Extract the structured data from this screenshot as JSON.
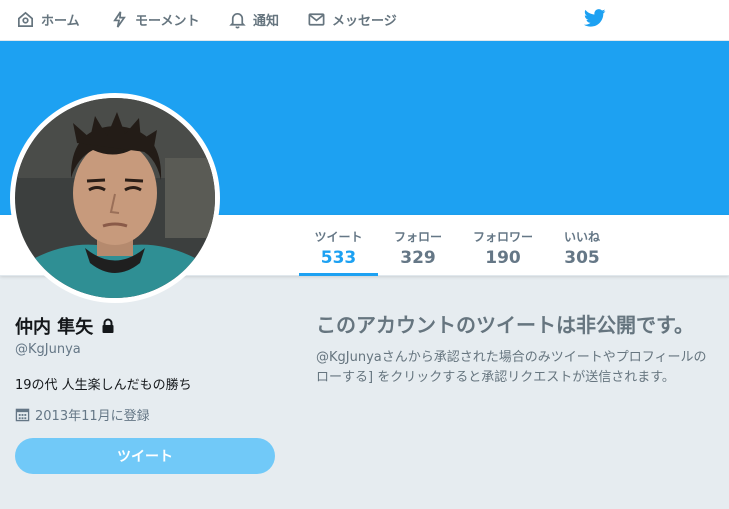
{
  "nav": {
    "home": "ホーム",
    "moments": "モーメント",
    "notifications": "通知",
    "messages": "メッセージ",
    "brand_color": "#1da1f2"
  },
  "header": {
    "banner_color": "#1da1f2"
  },
  "stats": [
    {
      "label": "ツイート",
      "value": "533",
      "active": true
    },
    {
      "label": "フォロー",
      "value": "329",
      "active": false
    },
    {
      "label": "フォロワー",
      "value": "190",
      "active": false
    },
    {
      "label": "いいね",
      "value": "305",
      "active": false
    }
  ],
  "profile": {
    "name": "仲内 隼矢",
    "handle": "@KgJunya",
    "bio": "19の代 人生楽しんだもの勝ち",
    "joined": "2013年11月に登録",
    "protected_icon": "lock-icon",
    "tweet_button": "ツイート"
  },
  "protected": {
    "title": "このアカウントのツイートは非公開です。",
    "line1": "@KgJunyaさんから承認された場合のみツイートやプロフィールの",
    "line2": "ローする] をクリックすると承認リクエストが送信されます。"
  }
}
